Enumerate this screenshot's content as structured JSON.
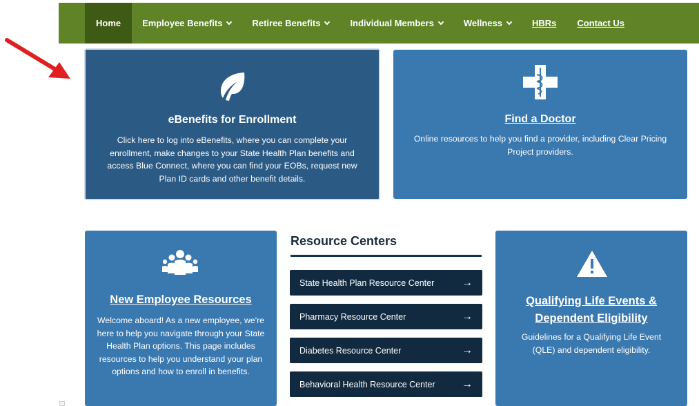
{
  "nav": {
    "items": [
      {
        "label": "Home",
        "chevron": false
      },
      {
        "label": "Employee Benefits",
        "chevron": true
      },
      {
        "label": "Retiree Benefits",
        "chevron": true
      },
      {
        "label": "Individual Members",
        "chevron": true
      },
      {
        "label": "Wellness",
        "chevron": true
      },
      {
        "label": "HBRs",
        "chevron": false
      },
      {
        "label": "Contact Us",
        "chevron": false
      }
    ]
  },
  "cards": {
    "ebenefits": {
      "icon": "leaf-icon",
      "title": "eBenefits for Enrollment",
      "text": "Click here to log into eBenefits, where you can complete your enrollment, make changes to your State Health Plan benefits and access Blue Connect, where you can find your EOBs, request new Plan ID cards and other benefit details."
    },
    "doctor": {
      "icon": "medical-cross-icon",
      "title": "Find a Doctor",
      "text": "Online resources to help you find a provider, including Clear Pricing Project providers."
    },
    "new_employee": {
      "icon": "people-group-icon",
      "title": "New Employee Resources",
      "text": "Welcome aboard! As a new employee, we're here to help you navigate through your State Health Plan options. This page includes resources to help you understand your plan options and how to enroll in benefits."
    },
    "qle": {
      "icon": "warning-triangle-icon",
      "title": "Qualifying Life Events & Dependent Eligibility",
      "text": "Guidelines for a Qualifying Life Event (QLE) and dependent eligibility."
    }
  },
  "resource_centers": {
    "heading": "Resource Centers",
    "items": [
      {
        "label": "State Health Plan Resource Center"
      },
      {
        "label": "Pharmacy Resource Center"
      },
      {
        "label": "Diabetes Resource Center"
      },
      {
        "label": "Behavioral Health Resource Center"
      }
    ]
  },
  "colors": {
    "nav_green": "#5f8326",
    "nav_active": "#3e5a15",
    "card_blue": "#3a78b0",
    "card_dark_blue": "#2b5b85",
    "button_navy": "#122a40",
    "arrow_red": "#e02020"
  }
}
